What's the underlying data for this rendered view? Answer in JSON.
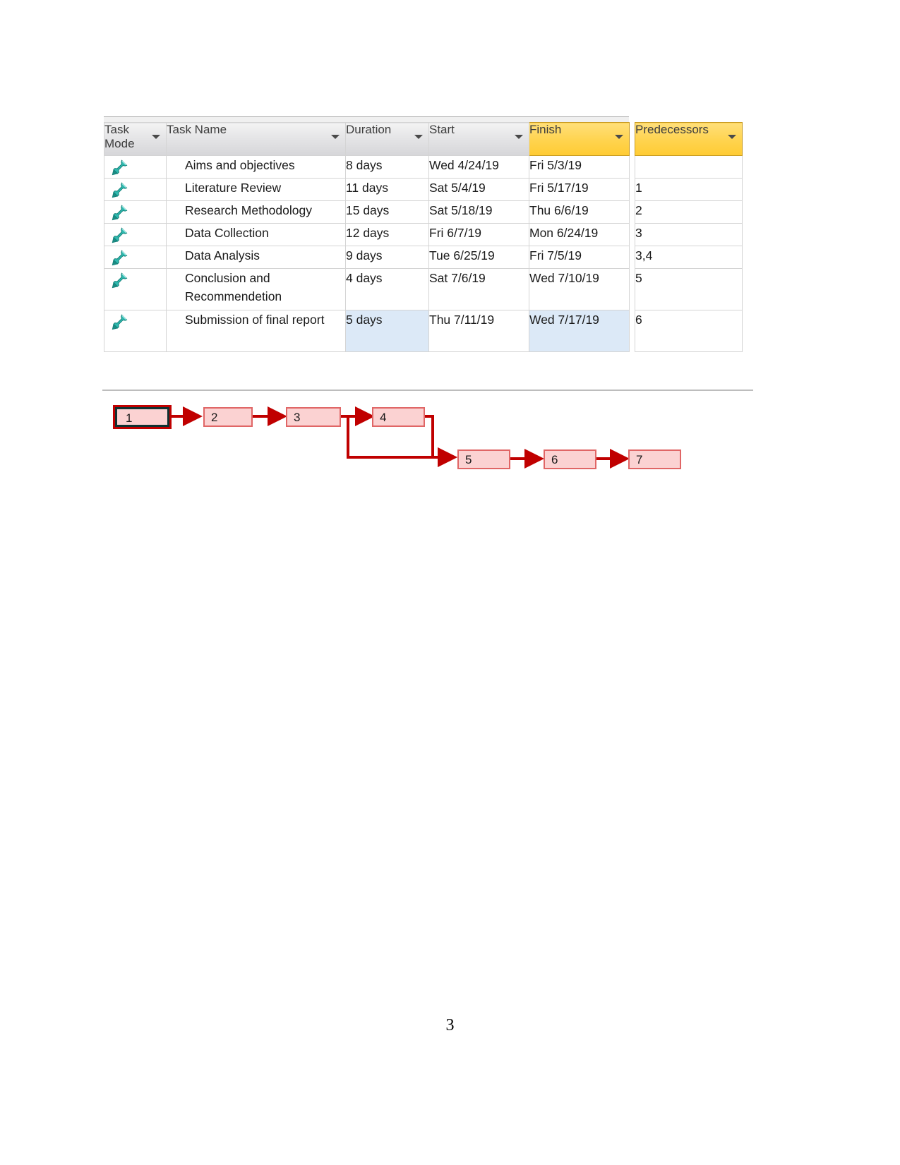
{
  "document": {
    "page_number": "3"
  },
  "project_table": {
    "columns": [
      {
        "key": "task_mode",
        "label": "Task Mode",
        "highlighted": false,
        "has_sort_arrow": true
      },
      {
        "key": "task_name",
        "label": "Task Name",
        "highlighted": false,
        "has_sort_arrow": true
      },
      {
        "key": "duration",
        "label": "Duration",
        "highlighted": false,
        "has_sort_arrow": true
      },
      {
        "key": "start",
        "label": "Start",
        "highlighted": false,
        "has_sort_arrow": true
      },
      {
        "key": "finish",
        "label": "Finish",
        "highlighted": true,
        "has_sort_arrow": true
      },
      {
        "key": "predecessors",
        "label": "Predecessors",
        "highlighted": true,
        "has_sort_arrow": true
      }
    ],
    "mode_icon": "pushpin-icon",
    "rows": [
      {
        "task_mode": "pushpin-icon",
        "task_name": "Aims and objectives",
        "duration": "8 days",
        "start": "Wed 4/24/19",
        "finish": "Fri 5/3/19",
        "predecessors": ""
      },
      {
        "task_mode": "pushpin-icon",
        "task_name": "Literature Review",
        "duration": "11 days",
        "start": "Sat 5/4/19",
        "finish": "Fri 5/17/19",
        "predecessors": "1"
      },
      {
        "task_mode": "pushpin-icon",
        "task_name": "Research Methodology",
        "duration": "15 days",
        "start": "Sat 5/18/19",
        "finish": "Thu 6/6/19",
        "predecessors": "2"
      },
      {
        "task_mode": "pushpin-icon",
        "task_name": "Data Collection",
        "duration": "12 days",
        "start": "Fri 6/7/19",
        "finish": "Mon 6/24/19",
        "predecessors": "3"
      },
      {
        "task_mode": "pushpin-icon",
        "task_name": "Data Analysis",
        "duration": "9 days",
        "start": "Tue 6/25/19",
        "finish": "Fri 7/5/19",
        "predecessors": "3,4"
      },
      {
        "task_mode": "pushpin-icon",
        "task_name": "Conclusion and Recommendetion",
        "duration": "4 days",
        "start": "Sat 7/6/19",
        "finish": "Wed 7/10/19",
        "predecessors": "5"
      },
      {
        "task_mode": "pushpin-icon",
        "task_name": "Submission of final report",
        "duration": "5 days",
        "start": "Thu 7/11/19",
        "finish": "Wed 7/17/19",
        "predecessors": "6"
      }
    ],
    "selected_row_index": 6,
    "selected_cells": [
      "duration",
      "finish"
    ]
  },
  "network_diagram": {
    "nodes": [
      {
        "id": "1",
        "label": "1",
        "selected": true
      },
      {
        "id": "2",
        "label": "2",
        "selected": false
      },
      {
        "id": "3",
        "label": "3",
        "selected": false
      },
      {
        "id": "4",
        "label": "4",
        "selected": false
      },
      {
        "id": "5",
        "label": "5",
        "selected": false
      },
      {
        "id": "6",
        "label": "6",
        "selected": false
      },
      {
        "id": "7",
        "label": "7",
        "selected": false
      }
    ],
    "links": [
      {
        "from": "1",
        "to": "2"
      },
      {
        "from": "2",
        "to": "3"
      },
      {
        "from": "3",
        "to": "4"
      },
      {
        "from": "3",
        "to": "5"
      },
      {
        "from": "4",
        "to": "5"
      },
      {
        "from": "5",
        "to": "6"
      },
      {
        "from": "6",
        "to": "7"
      }
    ]
  },
  "colors": {
    "header_default": "#e2e2e4",
    "header_highlight": "#ffd34d",
    "selection_fill": "#dce9f7",
    "node_fill": "#fbd2d2",
    "node_border": "#e06666",
    "link_line": "#c00000",
    "node_selected_border": "#0f3131"
  }
}
